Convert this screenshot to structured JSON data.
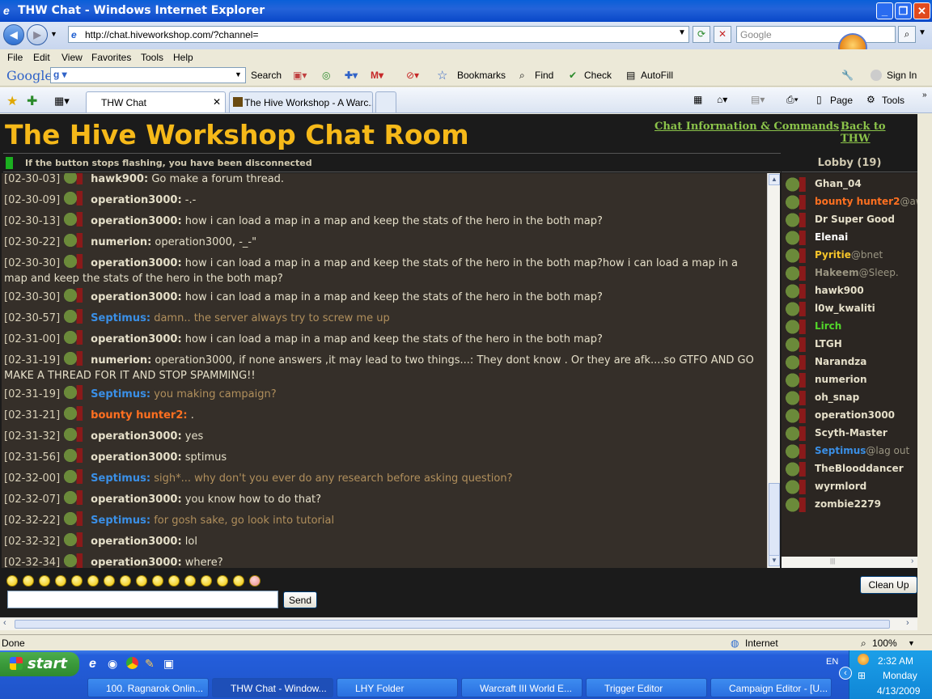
{
  "window": {
    "title": "THW Chat - Windows Internet Explorer"
  },
  "address": {
    "url": "http://chat.hiveworkshop.com/?channel=",
    "search_placeholder": "Google"
  },
  "menu": [
    "File",
    "Edit",
    "View",
    "Favorites",
    "Tools",
    "Help"
  ],
  "googlebar": {
    "logo": "Google",
    "search": "Search",
    "bookmarks": "Bookmarks",
    "find": "Find",
    "check": "Check",
    "autofill": "AutoFill",
    "signin": "Sign In"
  },
  "tabs": [
    {
      "label": "THW Chat"
    },
    {
      "label": "The Hive Workshop - A Warc..."
    }
  ],
  "commandbar": {
    "page": "Page",
    "tools": "Tools"
  },
  "chat": {
    "title": "The Hive Workshop Chat Room",
    "info_link": "Chat Information & Commands",
    "back_link": "Back to THW",
    "warning": "If the button stops flashing, you have been disconnected",
    "lobby": "Lobby (19)",
    "messages": [
      {
        "time": "[02-30-03]",
        "user": "hawk900",
        "text": " Go make a forum thread.",
        "color": "#e5dfc9",
        "textcolor": "#e5dfc9"
      },
      {
        "time": "[02-30-09]",
        "user": "operation3000",
        "text": " -.-",
        "color": "#e5dfc9",
        "textcolor": "#e5dfc9"
      },
      {
        "time": "[02-30-13]",
        "user": "operation3000",
        "text": " how i can load a map in a map and keep the stats of the hero in the both map?",
        "color": "#e5dfc9",
        "textcolor": "#e5dfc9"
      },
      {
        "time": "[02-30-22]",
        "user": "numerion",
        "text": " operation3000, -_-\"",
        "color": "#e5dfc9",
        "textcolor": "#e5dfc9"
      },
      {
        "time": "[02-30-30]",
        "user": "operation3000",
        "text": " how i can load a map in a map and keep the stats of the hero in the both map?how i can load a map in a map and keep the stats of the hero in the both map?",
        "color": "#e5dfc9",
        "textcolor": "#e5dfc9"
      },
      {
        "time": "[02-30-30]",
        "user": "operation3000",
        "text": " how i can load a map in a map and keep the stats of the hero in the both map?",
        "color": "#e5dfc9",
        "textcolor": "#e5dfc9"
      },
      {
        "time": "[02-30-57]",
        "user": "Septimus",
        "text": " damn.. the server always try to screw me up",
        "color": "#3a8fe6",
        "textcolor": "#b08f5c"
      },
      {
        "time": "[02-31-00]",
        "user": "operation3000",
        "text": " how i can load a map in a map and keep the stats of the hero in the both map?",
        "color": "#e5dfc9",
        "textcolor": "#e5dfc9"
      },
      {
        "time": "[02-31-19]",
        "user": "numerion",
        "text": " operation3000, if none answers ,it may lead to two things...: They dont know . Or they are afk....so GTFO AND GO MAKE A THREAD FOR IT AND STOP SPAMMING!!",
        "color": "#e5dfc9",
        "textcolor": "#e5dfc9"
      },
      {
        "time": "[02-31-19]",
        "user": "Septimus",
        "text": " you making campaign?",
        "color": "#3a8fe6",
        "textcolor": "#b08f5c"
      },
      {
        "time": "[02-31-21]",
        "user": "bounty hunter2",
        "text": " .",
        "color": "#ff7020",
        "textcolor": "#e5dfc9"
      },
      {
        "time": "[02-31-32]",
        "user": "operation3000",
        "text": " yes",
        "color": "#e5dfc9",
        "textcolor": "#e5dfc9"
      },
      {
        "time": "[02-31-56]",
        "user": "operation3000",
        "text": " sptimus",
        "color": "#e5dfc9",
        "textcolor": "#e5dfc9"
      },
      {
        "time": "[02-32-00]",
        "user": "Septimus",
        "text": " sigh*... why don't you ever do any research before asking question?",
        "color": "#3a8fe6",
        "textcolor": "#b08f5c"
      },
      {
        "time": "[02-32-07]",
        "user": "operation3000",
        "text": " you know how to do that?",
        "color": "#e5dfc9",
        "textcolor": "#e5dfc9"
      },
      {
        "time": "[02-32-22]",
        "user": "Septimus",
        "text": " for gosh sake, go look into tutorial",
        "color": "#3a8fe6",
        "textcolor": "#b08f5c"
      },
      {
        "time": "[02-32-32]",
        "user": "operation3000",
        "text": " lol",
        "color": "#e5dfc9",
        "textcolor": "#e5dfc9"
      },
      {
        "time": "[02-32-34]",
        "user": "operation3000",
        "text": " where?",
        "color": "#e5dfc9",
        "textcolor": "#e5dfc9"
      }
    ],
    "users": [
      {
        "name": "Ghan_04",
        "status": "",
        "color": "#e5dfc9"
      },
      {
        "name": "bounty hunter2",
        "status": "@aw",
        "color": "#ff7020"
      },
      {
        "name": "Dr Super Good",
        "status": "",
        "color": "#e5dfc9"
      },
      {
        "name": "Elenai",
        "status": "",
        "color": "#ffffff"
      },
      {
        "name": "Pyritie",
        "status": "@bnet",
        "color": "#f6c52a"
      },
      {
        "name": "Hakeem",
        "status": "@Sleep.",
        "color": "#9a9582"
      },
      {
        "name": "hawk900",
        "status": "",
        "color": "#e5dfc9"
      },
      {
        "name": "l0w_kwaliti",
        "status": "",
        "color": "#e5dfc9"
      },
      {
        "name": "Lirch",
        "status": "",
        "color": "#52d62a"
      },
      {
        "name": "LTGH",
        "status": "",
        "color": "#e5dfc9"
      },
      {
        "name": "Narandza",
        "status": "",
        "color": "#e5dfc9"
      },
      {
        "name": "numerion",
        "status": "",
        "color": "#e5dfc9"
      },
      {
        "name": "oh_snap",
        "status": "",
        "color": "#e5dfc9"
      },
      {
        "name": "operation3000",
        "status": "",
        "color": "#e5dfc9"
      },
      {
        "name": "Scyth-Master",
        "status": "",
        "color": "#e5dfc9"
      },
      {
        "name": "Septimus",
        "status": "@lag out",
        "color": "#3a8fe6"
      },
      {
        "name": "TheBlooddancer",
        "status": "",
        "color": "#e5dfc9"
      },
      {
        "name": "wyrmlord",
        "status": "",
        "color": "#e5dfc9"
      },
      {
        "name": "zombie2279",
        "status": "",
        "color": "#e5dfc9"
      }
    ],
    "send": "Send",
    "cleanup": "Clean Up"
  },
  "status": {
    "left": "Done",
    "zone": "Internet",
    "zoom": "100%"
  },
  "taskbar": {
    "start": "start",
    "tasks": [
      "100. Ragnarok Onlin...",
      "THW Chat - Window...",
      "LHY Folder",
      "Warcraft III World E...",
      "Trigger Editor",
      "Campaign Editor - [U..."
    ],
    "lang": "EN",
    "time": "2:32 AM",
    "day": "Monday",
    "date": "4/13/2009"
  }
}
